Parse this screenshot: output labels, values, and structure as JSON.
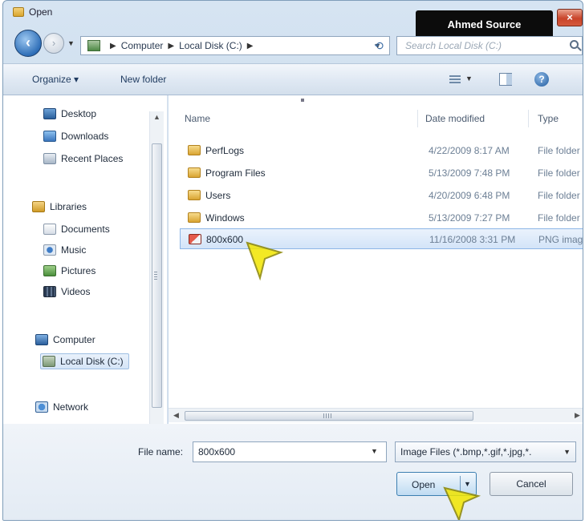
{
  "window": {
    "title": "Open"
  },
  "watermark": "Ahmed Source",
  "close_button": "×",
  "address_bar": {
    "crumbs": [
      "Computer",
      "Local Disk (C:)"
    ],
    "back": "‹",
    "forward": "›"
  },
  "search": {
    "placeholder": "Search Local Disk (C:)"
  },
  "toolbar": {
    "organize": "Organize ▾",
    "new_folder": "New folder",
    "help": "?"
  },
  "nav": {
    "items": [
      {
        "label": "Desktop",
        "icon": "desktop-icon"
      },
      {
        "label": "Downloads",
        "icon": "downloads-icon"
      },
      {
        "label": "Recent Places",
        "icon": "recent-places-icon"
      },
      {
        "label": "Libraries",
        "icon": "libraries-icon"
      },
      {
        "label": "Documents",
        "icon": "documents-icon"
      },
      {
        "label": "Music",
        "icon": "music-icon"
      },
      {
        "label": "Pictures",
        "icon": "pictures-icon"
      },
      {
        "label": "Videos",
        "icon": "videos-icon"
      },
      {
        "label": "Computer",
        "icon": "computer-icon"
      },
      {
        "label": "Local Disk (C:)",
        "icon": "local-disk-icon"
      },
      {
        "label": "Network",
        "icon": "network-icon"
      }
    ]
  },
  "columns": {
    "name": "Name",
    "date": "Date modified",
    "type": "Type"
  },
  "files": [
    {
      "name": "PerfLogs",
      "date": "4/22/2009 8:17 AM",
      "type": "File folder",
      "icon": "folder-icon"
    },
    {
      "name": "Program Files",
      "date": "5/13/2009 7:48 PM",
      "type": "File folder",
      "icon": "folder-icon"
    },
    {
      "name": "Users",
      "date": "4/20/2009 6:48 PM",
      "type": "File folder",
      "icon": "folder-icon"
    },
    {
      "name": "Windows",
      "date": "5/13/2009 7:27 PM",
      "type": "File folder",
      "icon": "folder-icon"
    },
    {
      "name": "800x600",
      "date": "11/16/2008 3:31 PM",
      "type": "PNG image",
      "icon": "png-file-icon",
      "selected": true
    }
  ],
  "bottom": {
    "file_name_label": "File name:",
    "file_name_value": "800x600",
    "filter_value": "Image Files (*.bmp,*.gif,*.jpg,*.",
    "open_label": "Open",
    "cancel_label": "Cancel"
  },
  "colors": {
    "accent": "#3c7fb1",
    "selection": "#d3e4f8",
    "close": "#c9442a",
    "cursor": "#f2e600"
  }
}
